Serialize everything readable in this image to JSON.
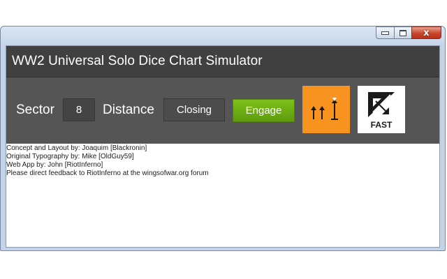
{
  "window": {
    "controls": {
      "minimize_icon": "minimize-icon",
      "maximize_icon": "maximize-icon",
      "close_icon": "close-icon",
      "close_glyph": "x"
    }
  },
  "app": {
    "title": "WW2 Universal Solo Dice Chart Simulator"
  },
  "toolbar": {
    "sector_label": "Sector",
    "sector_value": "8",
    "distance_label": "Distance",
    "distance_value": "Closing",
    "engage_label": "Engage",
    "move_card": {
      "icon": "maneuver-arrows-icon",
      "color": "#f7931e"
    },
    "speed_card": {
      "icon": "fast-speed-icon",
      "label": "FAST"
    }
  },
  "credits": [
    "Concept and Layout by: Joaquim [Blackronin]",
    "Original Typography by: Mike [OldGuy59]",
    "Web App by: John [RiotInferno]",
    "Please direct feedback to RiotInferno at the wingsofwar.org forum"
  ],
  "colors": {
    "header_bg": "#404040",
    "toolbar_bg": "#555555",
    "engage_green": "#6aac12",
    "move_orange": "#f7931e"
  }
}
